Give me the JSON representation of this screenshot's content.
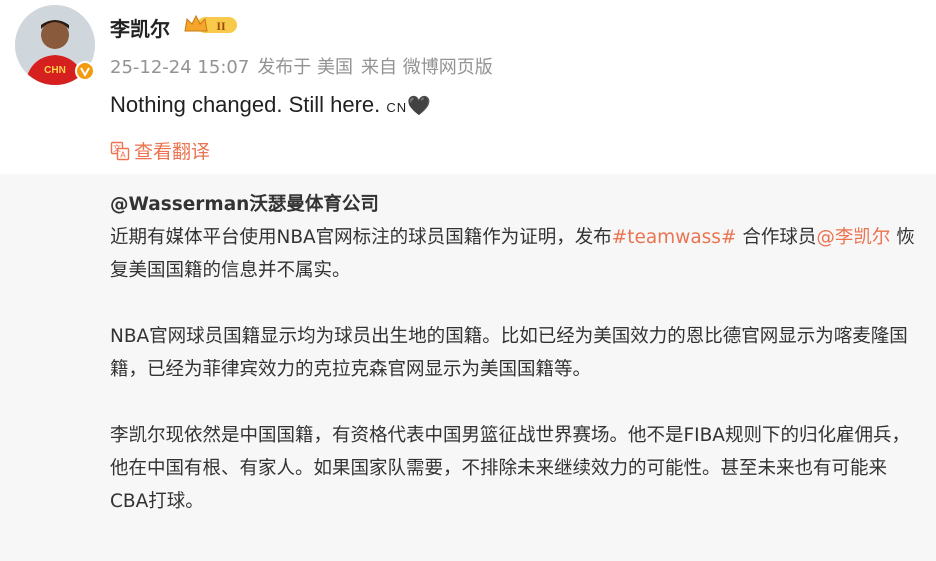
{
  "post": {
    "username": "李凯尔",
    "vip_level": "II",
    "meta": {
      "time": "25-12-24 15:07",
      "location": "发布于 美国",
      "source": "来自 微博网页版"
    },
    "text": "Nothing changed. Still here.",
    "text_suffix": "CN",
    "heart": "🖤",
    "translate_label": "查看翻译",
    "avatar_jersey_text": "CHN"
  },
  "repost": {
    "author": "@Wasserman沃瑟曼体育公司",
    "p1_a": "近期有媒体平台使用NBA官网标注的球员国籍作为证明，发布",
    "p1_tag": "#teamwass#",
    "p1_b": " 合作球员",
    "p1_mention": "@李凯尔",
    "p1_c": " 恢复美国国籍的信息并不属实。",
    "p2": "NBA官网球员国籍显示均为球员出生地的国籍。比如已经为美国效力的恩比德官网显示为喀麦隆国籍，已经为菲律宾效力的克拉克森官网显示为美国国籍等。",
    "p3": "李凯尔现依然是中国国籍，有资格代表中国男篮征战世界赛场。他不是FIBA规则下的归化雇佣兵，他在中国有根、有家人。如果国家队需要，不排除未来继续效力的可能性。甚至未来也有可能来CBA打球。"
  },
  "colors": {
    "accent": "#eb7350",
    "meta": "#939393",
    "repost_bg": "#f7f7f7",
    "verified": "#f49a0d"
  }
}
